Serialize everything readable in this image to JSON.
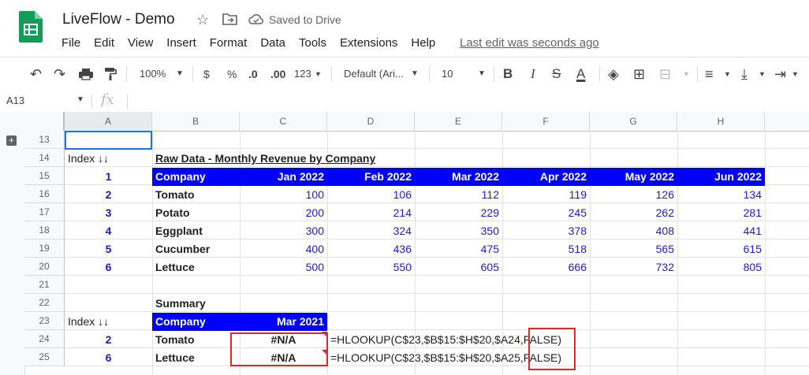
{
  "app": {
    "title": "LiveFlow - Demo",
    "saved_status": "Saved to Drive",
    "menu": [
      "File",
      "Edit",
      "View",
      "Insert",
      "Format",
      "Data",
      "Tools",
      "Extensions",
      "Help"
    ],
    "last_edit": "Last edit was seconds ago"
  },
  "toolbar": {
    "zoom": "100%",
    "currency": "$",
    "percent": "%",
    "dec_less": ".0",
    "dec_more": ".00",
    "more_formats": "123",
    "font": "Default (Ari...",
    "font_size": "10",
    "bold": "B",
    "italic": "I",
    "strike": "S",
    "text_color": "A"
  },
  "formula_bar": {
    "name_box": "A13",
    "fx": "fx",
    "formula": ""
  },
  "columns": [
    "A",
    "B",
    "C",
    "D",
    "E",
    "F",
    "G",
    "H"
  ],
  "rows": [
    "13",
    "14",
    "15",
    "16",
    "17",
    "18",
    "19",
    "20",
    "21",
    "22",
    "23",
    "24",
    "25"
  ],
  "sheet": {
    "index_label": "Index ↓↓",
    "raw_title": "Raw Data - Monthly Revenue by Company",
    "raw_header": [
      "Company",
      "Jan 2022",
      "Feb 2022",
      "Mar 2022",
      "Apr 2022",
      "May 2022",
      "Jun 2022"
    ],
    "raw_index_header": "1",
    "raw_rows": [
      {
        "index": "2",
        "company": "Tomato",
        "values": [
          "100",
          "106",
          "112",
          "119",
          "126",
          "134"
        ]
      },
      {
        "index": "3",
        "company": "Potato",
        "values": [
          "200",
          "214",
          "229",
          "245",
          "262",
          "281"
        ]
      },
      {
        "index": "4",
        "company": "Eggplant",
        "values": [
          "300",
          "324",
          "350",
          "378",
          "408",
          "441"
        ]
      },
      {
        "index": "5",
        "company": "Cucumber",
        "values": [
          "400",
          "436",
          "475",
          "518",
          "565",
          "615"
        ]
      },
      {
        "index": "6",
        "company": "Lettuce",
        "values": [
          "500",
          "550",
          "605",
          "666",
          "732",
          "805"
        ]
      }
    ],
    "summary_title": "Summary",
    "summary_index_label": "Index ↓↓",
    "summary_header": [
      "Company",
      "Mar 2021"
    ],
    "summary_rows": [
      {
        "index": "2",
        "company": "Tomato",
        "value": "#N/A",
        "formula_pre": "=HLOOKUP(C$23,$B$15:$H$20,$A24,",
        "formula_hl": "FALSE)"
      },
      {
        "index": "6",
        "company": "Lettuce",
        "value": "#N/A",
        "formula_pre": "=HLOOKUP(C$23,$B$15:$H$20,$A25,",
        "formula_hl": "FALSE)"
      }
    ]
  },
  "colors": {
    "header_bg": "#0000ff",
    "value_text": "#1a1ad6",
    "error_box": "#e0282a",
    "sheets_green": "#0f9d58"
  }
}
